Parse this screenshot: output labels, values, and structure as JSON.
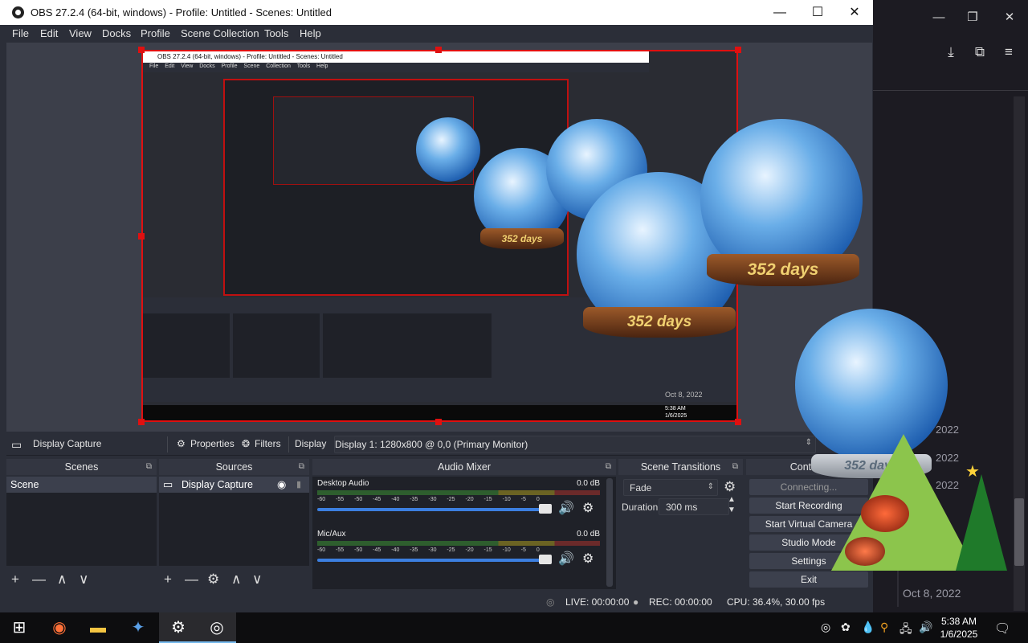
{
  "bg_app": {
    "window_controls": [
      "—",
      "❐",
      "✕"
    ],
    "tools": [
      "download-icon",
      "extensions-icon",
      "menu-icon"
    ],
    "years": [
      "2022",
      "2022",
      "2022"
    ],
    "date": "Oct 8, 2022"
  },
  "window": {
    "title": "OBS 27.2.4 (64-bit, windows) - Profile: Untitled - Scenes: Untitled",
    "minimize": "—",
    "maximize": "☐",
    "close": "✕"
  },
  "menu": [
    "File",
    "Edit",
    "View",
    "Docks",
    "Profile",
    "Scene Collection",
    "Tools",
    "Help"
  ],
  "preview": {
    "inner_title": "OBS 27.2.4 (64-bit, windows) - Profile: Untitled - Scenes: Untitled",
    "inner_menu": "File Edit View Docks Profile Scene Collection Tools Help",
    "globe_text": "352 days",
    "inner_date": "Oct 8, 2022",
    "inner_time": "5:38 AM",
    "inner_day": "1/6/2025"
  },
  "source_toolbar": {
    "source_name": "Display Capture",
    "properties": "Properties",
    "filters": "Filters",
    "display_label": "Display",
    "display_value": "Display 1: 1280x800 @ 0,0 (Primary Monitor)"
  },
  "scenes": {
    "header": "Scenes",
    "items": [
      "Scene"
    ]
  },
  "sources": {
    "header": "Sources",
    "items": [
      "Display Capture"
    ]
  },
  "mixer": {
    "header": "Audio Mixer",
    "ticks": "-60 -55 -50 -45 -40 -35 -30 -25 -20 -15 -10 -5 0",
    "channels": [
      {
        "name": "Desktop Audio",
        "db": "0.0 dB",
        "level": 0.96
      },
      {
        "name": "Mic/Aux",
        "db": "0.0 dB",
        "level": 0.96
      }
    ]
  },
  "transitions": {
    "header": "Scene Transitions",
    "type": "Fade",
    "duration_label": "Duration",
    "duration_value": "300 ms"
  },
  "controls": {
    "header": "Controls",
    "buttons": [
      "Connecting...",
      "Start Recording",
      "Start Virtual Camera",
      "Studio Mode",
      "Settings",
      "Exit"
    ]
  },
  "status": {
    "live": "LIVE: 00:00:00",
    "rec": "REC: 00:00:00",
    "cpu": "CPU: 36.4%, 30.00 fps"
  },
  "taskbar": {
    "time": "5:38 AM",
    "date": "1/6/2025"
  },
  "overlay": {
    "globe_text": "352 days"
  },
  "colors": {
    "obs_bg": "#2b2e38",
    "dock_body": "#1f2128",
    "selection_red": "#e01010",
    "accent_blue": "#3c7fe0"
  }
}
